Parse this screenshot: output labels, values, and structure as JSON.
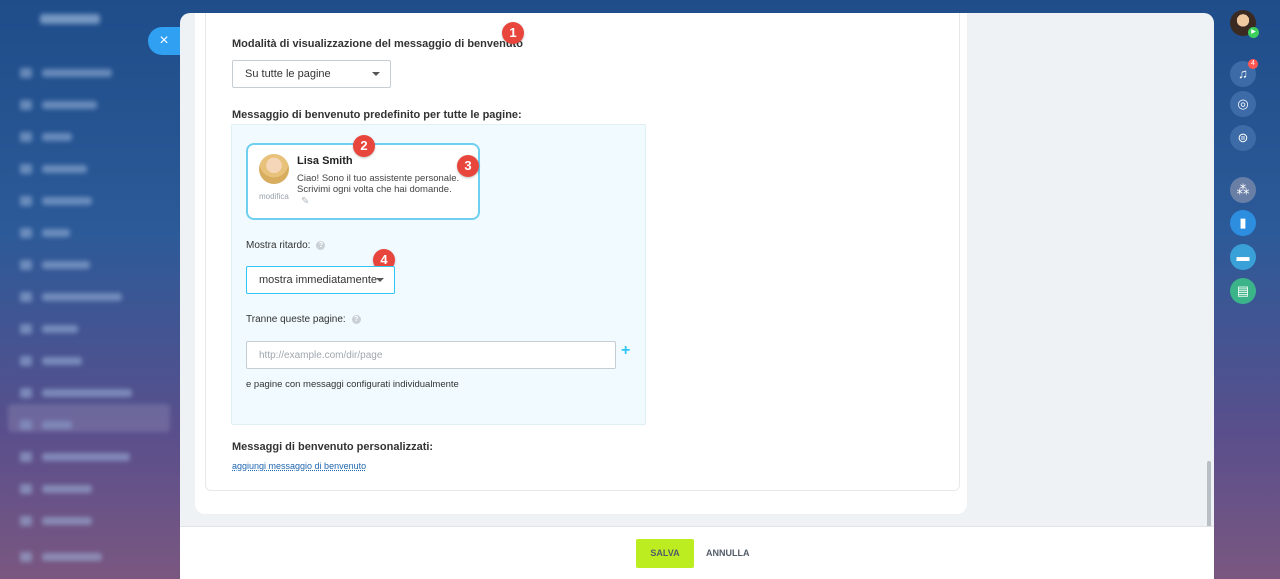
{
  "close": {
    "label": "×"
  },
  "settings": {
    "display_mode_title": "Modalità di visualizzazione del messaggio di benvenuto",
    "display_mode_value": "Su tutte le pagine",
    "default_message_title": "Messaggio di benvenuto predefinito per tutte le pagine:",
    "agent": {
      "name": "Lisa Smith",
      "message": [
        "Ciao! Sono il tuo assistente personale.",
        "Scrivimi ogni volta che hai domande."
      ],
      "edit_label": "modifica"
    },
    "delay_label": "Mostra ritardo:",
    "delay_value": "mostra immediatamente",
    "except_pages_label": "Tranne queste pagine:",
    "url_placeholder": "http://example.com/dir/page",
    "individual_note": "e pagine con messaggi configurati individualmente",
    "custom_messages_title": "Messaggi di benvenuto personalizzati:",
    "add_message_link": "aggiungi messaggio di benvenuto"
  },
  "markers": [
    "1",
    "2",
    "3",
    "4"
  ],
  "footer": {
    "save_label": "SALVA",
    "cancel_label": "ANNULLA"
  },
  "right_rail": {
    "notifications_count": "4"
  },
  "colors": {
    "accent": "#2fc6f6",
    "save_button": "#bbed21",
    "marker": "#e8463c",
    "close_button": "#2fa0f2"
  }
}
